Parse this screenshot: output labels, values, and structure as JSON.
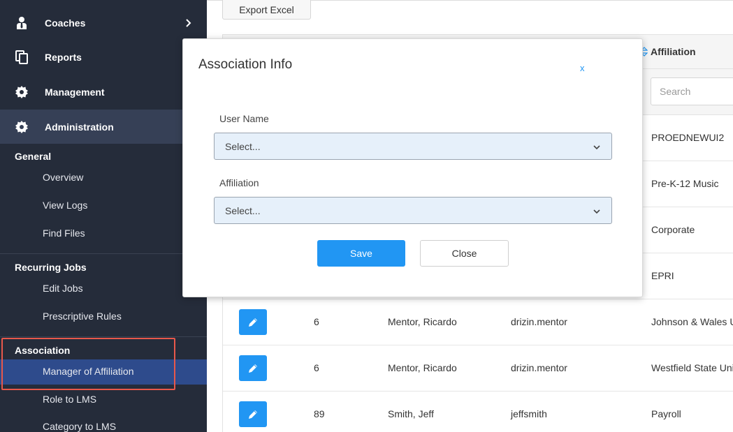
{
  "sidebar": {
    "main_items": [
      {
        "label": "Coaches",
        "icon": "user-tie-icon"
      },
      {
        "label": "Reports",
        "icon": "copy-icon"
      },
      {
        "label": "Management",
        "icon": "gear-icon"
      },
      {
        "label": "Administration",
        "icon": "gear-icon"
      }
    ],
    "sections": [
      {
        "title": "General",
        "items": [
          "Overview",
          "View Logs",
          "Find Files"
        ]
      },
      {
        "title": "Recurring Jobs",
        "items": [
          "Edit Jobs",
          "Prescriptive Rules"
        ]
      },
      {
        "title": "Association",
        "items": [
          "Manager of Affiliation",
          "Role to LMS",
          "Category to LMS"
        ]
      }
    ]
  },
  "toolbar": {
    "export_label": "Export Excel"
  },
  "table": {
    "header_affiliation": "Affiliation",
    "search_placeholder": "Search",
    "rows": [
      {
        "affiliation": "PROEDNEWUI2"
      },
      {
        "affiliation": "Pre-K-12 Music"
      },
      {
        "affiliation": "Corporate"
      },
      {
        "affiliation": "EPRI"
      },
      {
        "id": "6",
        "name": "Mentor, Ricardo",
        "username": "drizin.mentor",
        "affiliation": "Johnson & Wales U"
      },
      {
        "id": "6",
        "name": "Mentor, Ricardo",
        "username": "drizin.mentor",
        "affiliation": "Westfield State Uni"
      },
      {
        "id": "89",
        "name": "Smith, Jeff",
        "username": "jeffsmith",
        "affiliation": "Payroll"
      }
    ]
  },
  "modal": {
    "title": "Association Info",
    "close_x": "x",
    "user_name_label": "User Name",
    "user_name_value": "Select...",
    "affiliation_label": "Affiliation",
    "affiliation_value": "Select...",
    "save_label": "Save",
    "close_label": "Close"
  },
  "colors": {
    "sidebar_bg": "#252c3a",
    "sidebar_active": "#364056",
    "sub_active": "#2e4b8c",
    "highlight": "#e8584b",
    "primary": "#2196f3",
    "select_bg": "#e6f0fa"
  }
}
